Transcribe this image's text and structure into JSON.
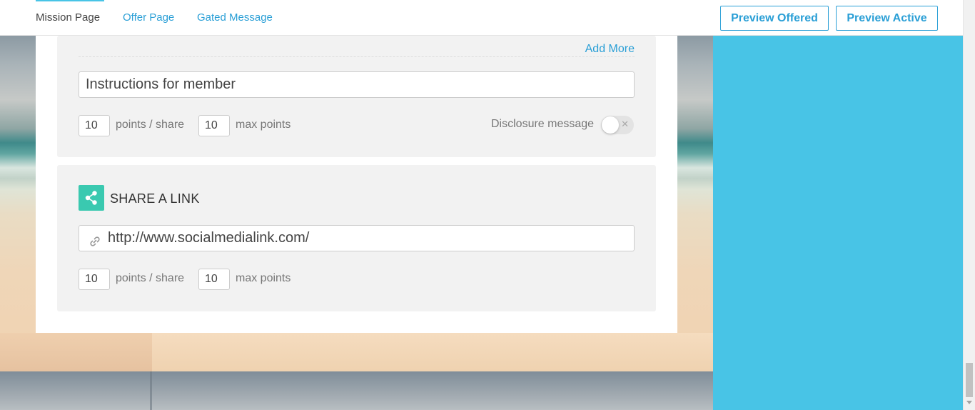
{
  "header": {
    "tabs": [
      {
        "label": "Mission Page",
        "active": true
      },
      {
        "label": "Offer Page",
        "active": false
      },
      {
        "label": "Gated Message",
        "active": false
      }
    ],
    "preview_offered": "Preview Offered",
    "preview_active": "Preview Active"
  },
  "colors": {
    "accent": "#2a9fd6",
    "right_panel": "#48c4e6",
    "share_icon_bg": "#3ac9b0"
  },
  "section1": {
    "add_more": "Add More",
    "instructions_placeholder": "Instructions for member",
    "points_per_share_value": "10",
    "points_per_share_label": "points / share",
    "max_points_value": "10",
    "max_points_label": "max points",
    "disclosure_label": "Disclosure message",
    "disclosure_enabled": false
  },
  "section2": {
    "title": "SHARE A LINK",
    "icon": "share-icon",
    "link_value": "http://www.socialmedialink.com/",
    "points_per_share_value": "10",
    "points_per_share_label": "points / share",
    "max_points_value": "10",
    "max_points_label": "max points"
  }
}
